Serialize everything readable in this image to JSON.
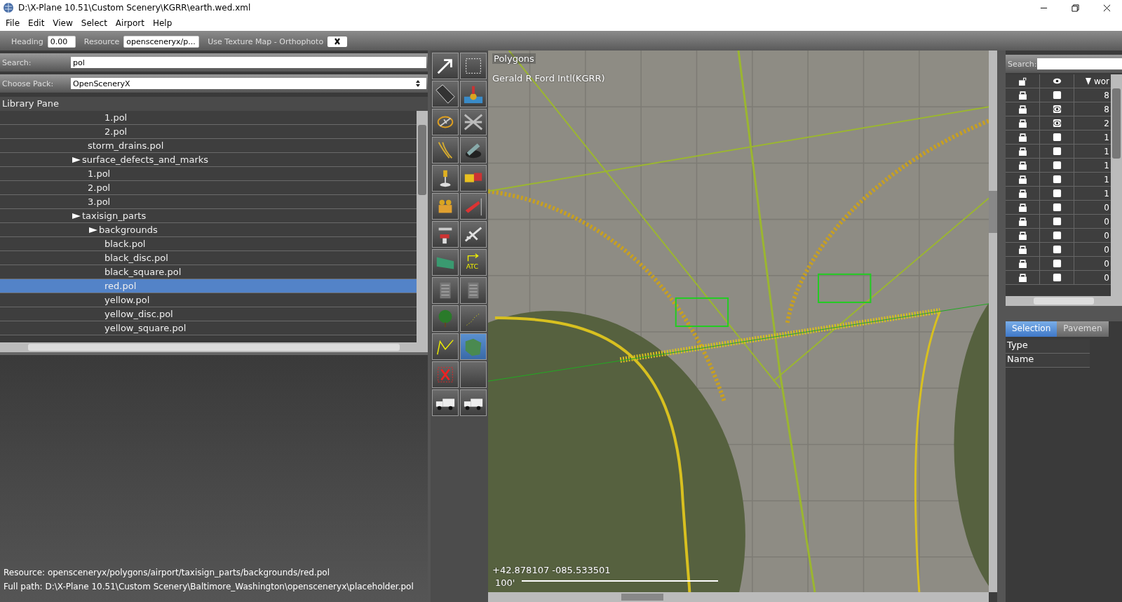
{
  "window": {
    "title": "D:\\X-Plane 10.51\\Custom Scenery\\KGRR\\earth.wed.xml"
  },
  "menu": [
    "File",
    "Edit",
    "View",
    "Select",
    "Airport",
    "Help"
  ],
  "toolbar": {
    "heading_label": "Heading",
    "heading": "0.00",
    "resource_label": "Resource",
    "resource": "opensceneryx/p...",
    "texture_label": "Use Texture Map - Orthophoto",
    "texture_checked": true
  },
  "library": {
    "search_label": "Search:",
    "search": "pol",
    "pack_label": "Choose Pack:",
    "pack": "OpenSceneryX",
    "title": "Library Pane",
    "items": [
      {
        "children": [
          {
            "children": [
              {
                "label": "1.pol",
                "selected": false
              },
              {
                "label": "2.pol",
                "selected": false
              }
            ]
          },
          {
            "label": "storm_drains.pol",
            "selected": false
          }
        ]
      },
      {
        "label": "surface_defects_and_marks",
        "selected": false,
        "children": [
          {
            "label": "1.pol",
            "selected": false
          },
          {
            "label": "2.pol",
            "selected": false
          },
          {
            "label": "3.pol",
            "selected": false
          }
        ]
      },
      {
        "label": "taxisign_parts",
        "selected": false,
        "children": [
          {
            "label": "backgrounds",
            "selected": false,
            "children": [
              {
                "label": "black.pol",
                "selected": false
              },
              {
                "label": "black_disc.pol",
                "selected": false
              },
              {
                "label": "black_square.pol",
                "selected": false
              },
              {
                "label": "red.pol",
                "selected": true
              },
              {
                "label": "yellow.pol",
                "selected": false
              },
              {
                "label": "yellow_disc.pol",
                "selected": false
              },
              {
                "label": "yellow_square.pol",
                "selected": false
              }
            ]
          }
        ]
      }
    ]
  },
  "status": [
    "Resource: opensceneryx/polygons/airport/taxisign_parts/backgrounds/red.pol",
    "Full path: D:\\X-Plane 10.51\\Custom Scenery\\Baltimore_Washington\\opensceneryx\\placeholder.pol"
  ],
  "tools": [
    {
      "selected": false
    },
    {
      "selected": false
    },
    {
      "selected": false
    },
    {
      "selected": false
    },
    {
      "selected": false
    },
    {
      "selected": false
    },
    {
      "selected": false
    },
    {
      "selected": false
    },
    {
      "selected": false
    },
    {
      "selected": false
    },
    {
      "selected": false
    },
    {
      "selected": false
    },
    {
      "selected": false
    },
    {
      "selected": false
    },
    {
      "selected": false
    },
    {
      "selected": false,
      "label": "ATC"
    },
    {
      "selected": false
    },
    {
      "selected": false
    },
    {
      "selected": false
    },
    {
      "selected": false
    },
    {
      "selected": false
    },
    {
      "selected": true
    },
    {
      "selected": false
    },
    {
      "selected": false
    },
    {
      "selected": false
    },
    {
      "selected": false
    }
  ],
  "map": {
    "mode": "Polygons",
    "airport": "Gerald R Ford Intl(KGRR)",
    "coords": "+42.878107 -085.533501",
    "scale": "100'"
  },
  "hierarchy": {
    "search_label": "Search:",
    "column_3": "wor",
    "rows": [
      {
        "locked": true,
        "visible": false,
        "column_3": "8"
      },
      {
        "locked": true,
        "visible": true,
        "column_3": "8"
      },
      {
        "locked": true,
        "visible": true,
        "column_3": "2"
      },
      {
        "locked": true,
        "visible": false,
        "column_3": "1"
      },
      {
        "locked": true,
        "visible": false,
        "column_3": "1"
      },
      {
        "locked": true,
        "visible": false,
        "column_3": "1"
      },
      {
        "locked": true,
        "visible": false,
        "column_3": "1"
      },
      {
        "locked": true,
        "visible": false,
        "column_3": "1"
      },
      {
        "locked": true,
        "visible": false,
        "column_3": "0"
      },
      {
        "locked": true,
        "visible": false,
        "column_3": "0"
      },
      {
        "locked": true,
        "visible": false,
        "column_3": "0"
      },
      {
        "locked": true,
        "visible": false,
        "column_3": "0"
      },
      {
        "locked": true,
        "visible": false,
        "column_3": "0"
      },
      {
        "locked": true,
        "visible": false,
        "column_3": "0"
      }
    ]
  },
  "inspector": {
    "tabs": [
      {
        "label": "Selection",
        "selected": true
      },
      {
        "label": "Pavemen",
        "selected": false
      }
    ],
    "fields": [
      "Type",
      "Name"
    ]
  }
}
